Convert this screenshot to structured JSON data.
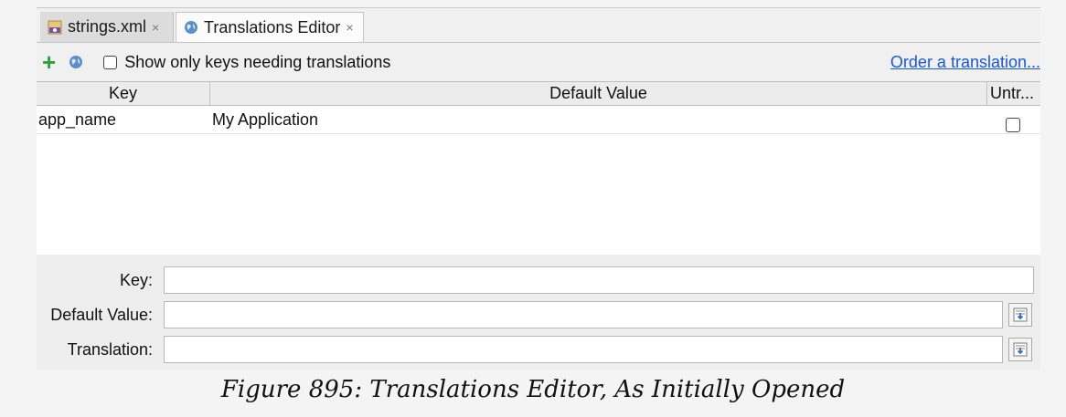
{
  "tabs": [
    {
      "label": "strings.xml",
      "close": "×"
    },
    {
      "label": "Translations Editor",
      "close": "×"
    }
  ],
  "toolbar": {
    "add_label": "+",
    "checkbox_label": "Show only keys needing translations",
    "order_link": "Order a translation..."
  },
  "table": {
    "columns": [
      "Key",
      "Default Value",
      "Untr..."
    ],
    "rows": [
      {
        "key": "app_name",
        "default_value": "My Application",
        "untranslatable": false
      }
    ]
  },
  "form": {
    "key_label": "Key:",
    "default_value_label": "Default Value:",
    "translation_label": "Translation:",
    "key_value": "",
    "default_value": "",
    "translation_value": ""
  },
  "caption": "Figure 895: Translations Editor, As Initially Opened",
  "colors": {
    "accent_link": "#1a57d0",
    "add_green": "#2aa33a"
  }
}
